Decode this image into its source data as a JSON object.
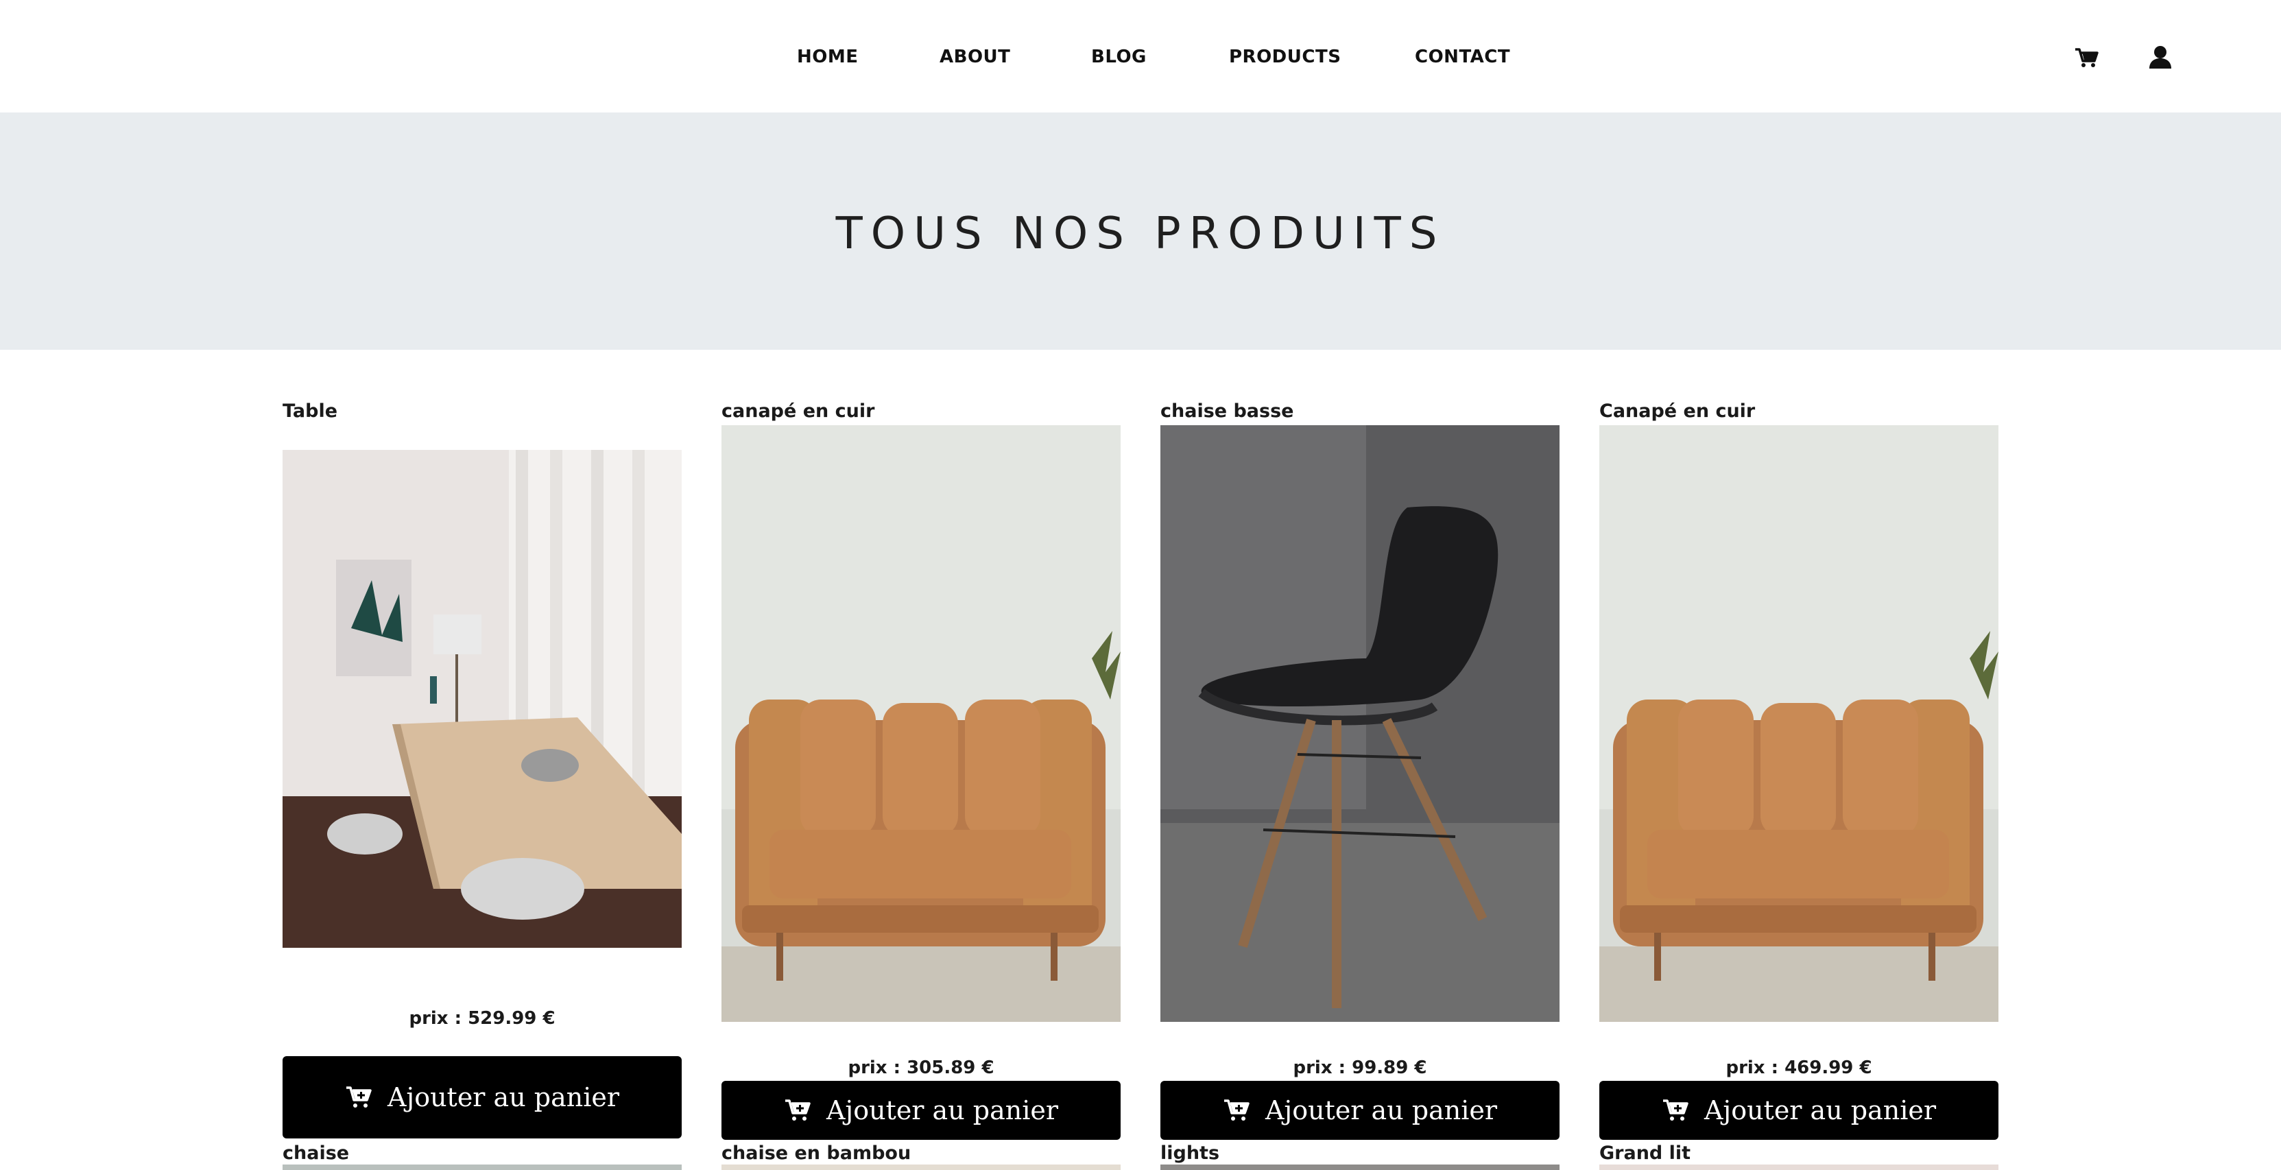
{
  "nav": {
    "links": [
      "HOME",
      "ABOUT",
      "BLOG",
      "PRODUCTS",
      "CONTACT"
    ],
    "cart_icon": "cart-icon",
    "user_icon": "user-icon"
  },
  "hero": {
    "title": "TOUS NOS PRODUITS"
  },
  "products": [
    {
      "name": "Table",
      "price": "prix : 529.99 €",
      "button": "Ajouter au panier",
      "image": "dining-table-photo"
    },
    {
      "name": "canapé en cuir",
      "price": "prix : 305.89 €",
      "button": "Ajouter au panier",
      "image": "leather-sofa-photo"
    },
    {
      "name": "chaise basse",
      "price": "prix : 99.89 €",
      "button": "Ajouter au panier",
      "image": "black-chair-photo"
    },
    {
      "name": "Canapé en cuir",
      "price": "prix : 469.99 €",
      "button": "Ajouter au panier",
      "image": "leather-sofa-photo"
    }
  ],
  "next_row": [
    "chaise",
    "chaise en bambou",
    "lights",
    "Grand lit"
  ],
  "colors": {
    "hero_bg": "#e8ecef",
    "button_bg": "#000000",
    "button_text": "#ffffff"
  }
}
